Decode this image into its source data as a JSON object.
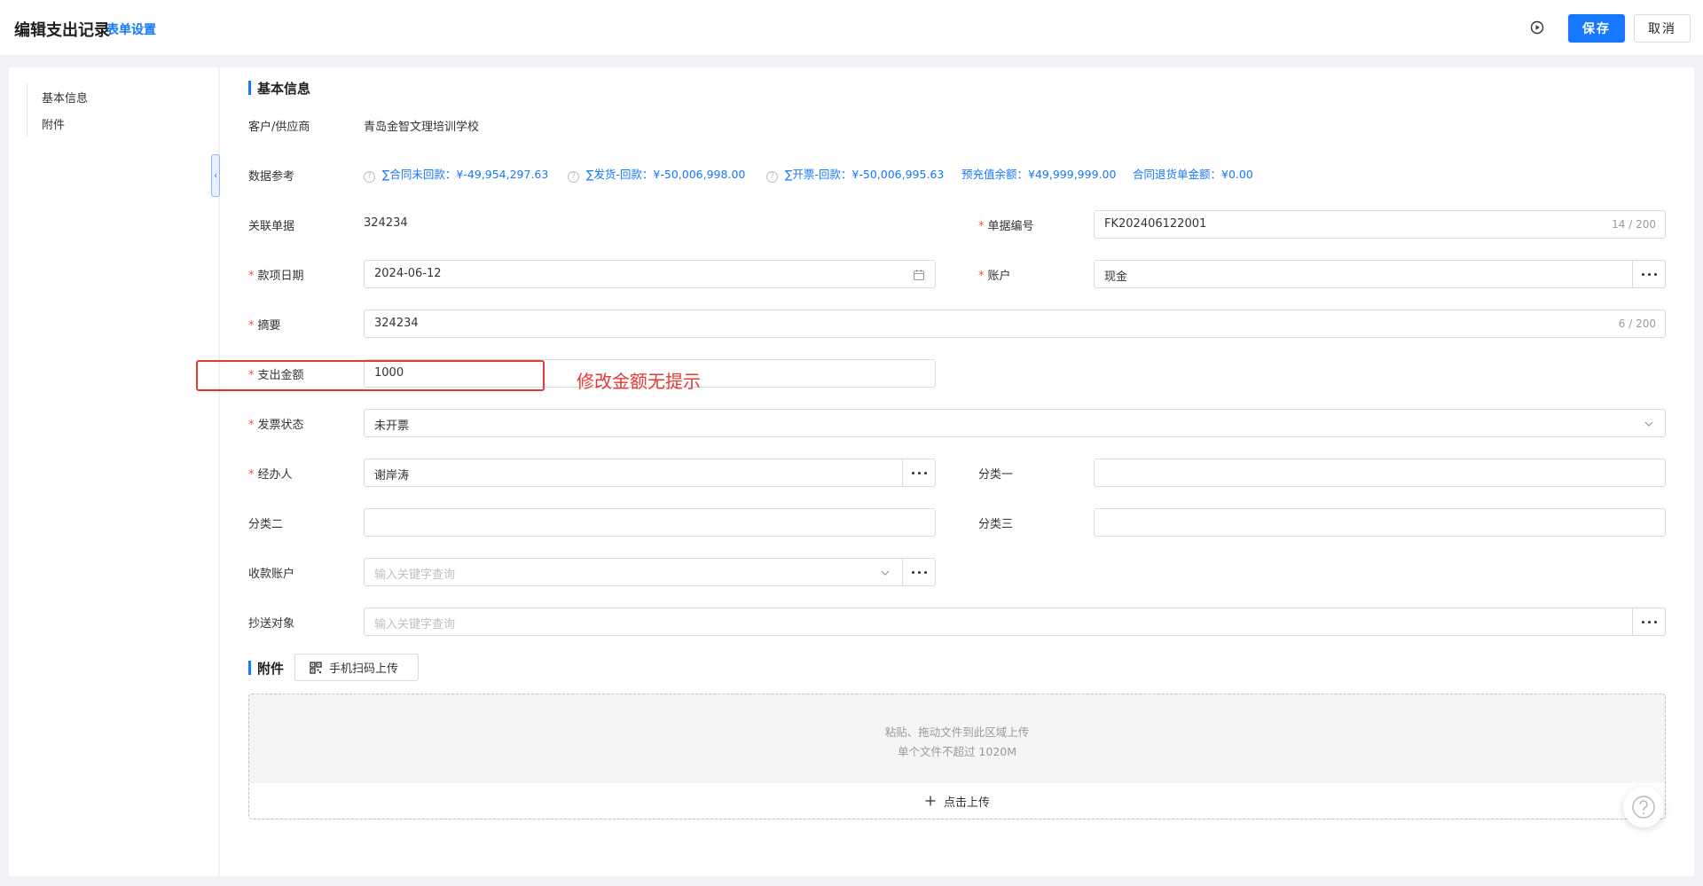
{
  "header": {
    "title": "编辑支出记录",
    "form_setting": "表单设置",
    "save_label": "保存",
    "cancel_label": "取消"
  },
  "sidebar": {
    "items": [
      {
        "label": "基本信息"
      },
      {
        "label": "附件"
      }
    ]
  },
  "basic_info": {
    "section_title": "基本信息",
    "customer": {
      "label": "客户/供应商",
      "value": "青岛金智文理培训学校"
    },
    "data_ref": {
      "label": "数据参考",
      "items": [
        {
          "text": "∑合同未回款：¥-49,954,297.63",
          "help": true
        },
        {
          "text": "∑发货-回款：¥-50,006,998.00",
          "help": true
        },
        {
          "text": "∑开票-回款：¥-50,006,995.63",
          "help": true
        },
        {
          "text": "预充值余额：¥49,999,999.00",
          "help": false
        },
        {
          "text": "合同退货单金额：¥0.00",
          "help": false
        }
      ]
    },
    "related_doc": {
      "label": "关联单据",
      "value": "324234"
    },
    "doc_no": {
      "label": "单据编号",
      "value": "FK202406122001",
      "count": "14 / 200"
    },
    "payment_date": {
      "label": "款项日期",
      "value": "2024-06-12"
    },
    "account": {
      "label": "账户",
      "value": "现金"
    },
    "summary": {
      "label": "摘要",
      "value": "324234",
      "count": "6 / 200"
    },
    "amount": {
      "label": "支出金额",
      "value": "1000"
    },
    "annotation": "修改金额无提示",
    "invoice_status": {
      "label": "发票状态",
      "value": "未开票"
    },
    "handler": {
      "label": "经办人",
      "value": "谢岸涛"
    },
    "category1": {
      "label": "分类一",
      "value": ""
    },
    "category2": {
      "label": "分类二",
      "value": ""
    },
    "category3": {
      "label": "分类三",
      "value": ""
    },
    "payee_account": {
      "label": "收款账户",
      "placeholder": "输入关键字查询"
    },
    "cc": {
      "label": "抄送对象",
      "placeholder": "输入关键字查询"
    },
    "required_mark": "*"
  },
  "attachments": {
    "section_title": "附件",
    "qr_upload": "手机扫码上传",
    "hint1": "粘贴、拖动文件到此区域上传",
    "hint2": "单个文件不超过 1020M",
    "upload_label": "点击上传"
  },
  "colors": {
    "primary": "#1677ff",
    "required": "#ff4d4f",
    "annotation": "#e53935"
  }
}
